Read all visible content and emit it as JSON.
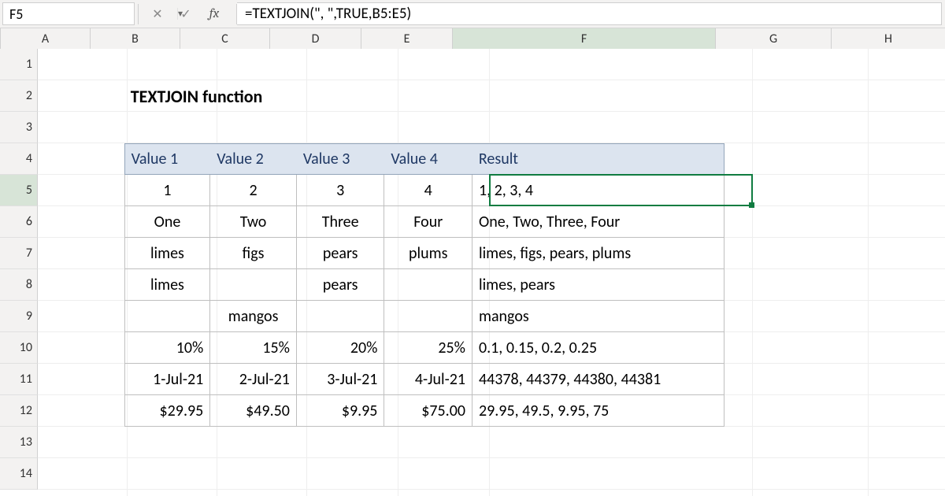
{
  "namebox": {
    "value": "F5"
  },
  "fx_label": "fx",
  "formula": "=TEXTJOIN(\", \",TRUE,B5:E5)",
  "columns": {
    "labels": [
      "A",
      "B",
      "C",
      "D",
      "E",
      "F",
      "G",
      "H"
    ],
    "widths": [
      114,
      114,
      114,
      116,
      116,
      334,
      147,
      145
    ],
    "selected_index": 5
  },
  "rows": {
    "labels": [
      "1",
      "2",
      "3",
      "4",
      "5",
      "6",
      "7",
      "8",
      "9",
      "10",
      "11",
      "12",
      "13",
      "14"
    ],
    "selected_index": 4
  },
  "title_cell": {
    "ref": "B2",
    "text": "TEXTJOIN function"
  },
  "table": {
    "header": [
      "Value 1",
      "Value 2",
      "Value 3",
      "Value 4",
      "Result"
    ],
    "rows": [
      {
        "v": [
          "1",
          "2",
          "3",
          "4"
        ],
        "res": "1, 2, 3, 4"
      },
      {
        "v": [
          "One",
          "Two",
          "Three",
          "Four"
        ],
        "res": "One, Two, Three, Four"
      },
      {
        "v": [
          "limes",
          "figs",
          "pears",
          "plums"
        ],
        "res": "limes, figs, pears, plums"
      },
      {
        "v": [
          "limes",
          "",
          "pears",
          ""
        ],
        "res": "limes, pears"
      },
      {
        "v": [
          "",
          "mangos",
          "",
          ""
        ],
        "res": "mangos"
      },
      {
        "v": [
          "10%",
          "15%",
          "20%",
          "25%"
        ],
        "res": "0.1, 0.15, 0.2, 0.25"
      },
      {
        "v": [
          "1-Jul-21",
          "2-Jul-21",
          "3-Jul-21",
          "4-Jul-21"
        ],
        "res": "44378, 44379, 44380, 44381"
      },
      {
        "v": [
          "$29.95",
          "$49.50",
          "$9.95",
          "$75.00"
        ],
        "res": "29.95, 49.5, 9.95, 75"
      }
    ]
  },
  "align": {
    "rows": [
      "center",
      "center",
      "center",
      "center",
      "center",
      "right",
      "right",
      "right"
    ]
  }
}
